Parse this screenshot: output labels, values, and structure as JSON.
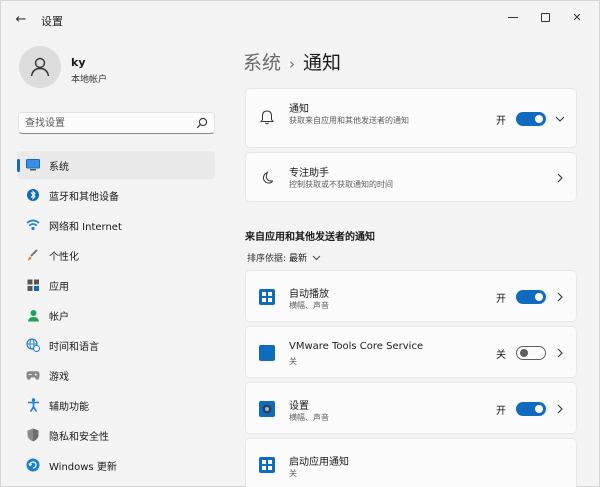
{
  "window": {
    "title": "设置",
    "back_glyph": "←",
    "close_glyph": "✕"
  },
  "profile": {
    "name": "ky",
    "account_type": "本地帐户"
  },
  "search": {
    "placeholder": "查找设置"
  },
  "sidebar": {
    "items": [
      {
        "label": "系统",
        "icon": "monitor-icon",
        "active": true
      },
      {
        "label": "蓝牙和其他设备",
        "icon": "bluetooth-icon"
      },
      {
        "label": "网络和 Internet",
        "icon": "wifi-icon"
      },
      {
        "label": "个性化",
        "icon": "brush-icon"
      },
      {
        "label": "应用",
        "icon": "apps-icon"
      },
      {
        "label": "帐户",
        "icon": "person-icon"
      },
      {
        "label": "时间和语言",
        "icon": "globe-clock-icon"
      },
      {
        "label": "游戏",
        "icon": "gamepad-icon"
      },
      {
        "label": "辅助功能",
        "icon": "accessibility-icon"
      },
      {
        "label": "隐私和安全性",
        "icon": "shield-icon"
      },
      {
        "label": "Windows 更新",
        "icon": "update-icon"
      }
    ]
  },
  "breadcrumb": {
    "parent": "系统",
    "separator": "›",
    "current": "通知"
  },
  "settings": {
    "notifications": {
      "title": "通知",
      "description": "获取来自应用和其他发送者的通知",
      "toggle_label": "开",
      "enabled": true
    },
    "focus_assist": {
      "title": "专注助手",
      "description": "控制获取或不获取通知的时间"
    }
  },
  "apps_section": {
    "header": "来自应用和其他发送者的通知",
    "sort_label": "排序依据:",
    "sort_value": "最新",
    "apps": [
      {
        "name": "自动播放",
        "detail": "横幅、声音",
        "toggle_label": "开",
        "enabled": true,
        "icon": "autoplay-app-icon"
      },
      {
        "name": "VMware Tools Core Service",
        "detail": "关",
        "toggle_label": "关",
        "enabled": false,
        "icon": "vmware-app-icon"
      },
      {
        "name": "设置",
        "detail": "横幅、声音",
        "toggle_label": "开",
        "enabled": true,
        "icon": "settings-app-icon"
      },
      {
        "name": "启动应用通知",
        "detail": "关",
        "icon": "startup-app-icon"
      }
    ]
  },
  "colors": {
    "accent": "#0f6cbd",
    "background": "#f3f3f3",
    "card": "#fbfbfb"
  }
}
